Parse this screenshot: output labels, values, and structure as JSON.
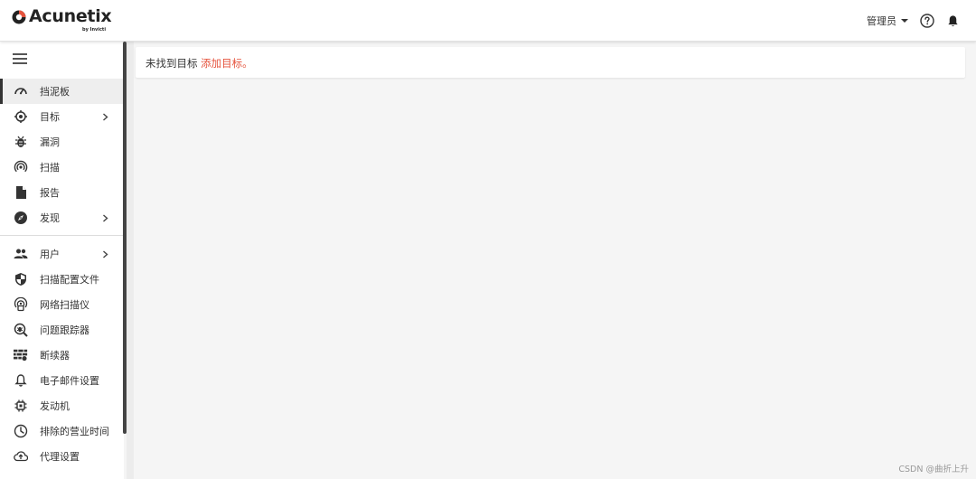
{
  "header": {
    "logo_text": "Acunetix",
    "logo_sub": "by Invicti",
    "user_label": "管理员"
  },
  "sidebar": {
    "items": [
      {
        "label": "挡泥板",
        "icon": "dashboard-icon",
        "active": true,
        "chevron": false
      },
      {
        "label": "目标",
        "icon": "target-icon",
        "active": false,
        "chevron": true
      },
      {
        "label": "漏洞",
        "icon": "bug-icon",
        "active": false,
        "chevron": false
      },
      {
        "label": "扫描",
        "icon": "radar-icon",
        "active": false,
        "chevron": false
      },
      {
        "label": "报告",
        "icon": "document-icon",
        "active": false,
        "chevron": false
      },
      {
        "label": "发现",
        "icon": "compass-icon",
        "active": false,
        "chevron": true
      },
      {
        "label": "用户",
        "icon": "users-icon",
        "active": false,
        "chevron": true
      },
      {
        "label": "扫描配置文件",
        "icon": "shield-icon",
        "active": false,
        "chevron": false
      },
      {
        "label": "网络扫描仪",
        "icon": "network-scanner-icon",
        "active": false,
        "chevron": false
      },
      {
        "label": "问题跟踪器",
        "icon": "issue-tracker-icon",
        "active": false,
        "chevron": false
      },
      {
        "label": "断续器",
        "icon": "firewall-icon",
        "active": false,
        "chevron": false
      },
      {
        "label": "电子邮件设置",
        "icon": "bell-outline-icon",
        "active": false,
        "chevron": false
      },
      {
        "label": "发动机",
        "icon": "chip-icon",
        "active": false,
        "chevron": false
      },
      {
        "label": "排除的营业时间",
        "icon": "clock-icon",
        "active": false,
        "chevron": false
      },
      {
        "label": "代理设置",
        "icon": "cloud-upload-icon",
        "active": false,
        "chevron": false
      }
    ]
  },
  "main": {
    "notice_text": "未找到目标",
    "notice_link": "添加目标。"
  },
  "watermark": "CSDN @曲折上升",
  "colors": {
    "accent": "#e5533d",
    "logo_red": "#e5533d"
  }
}
